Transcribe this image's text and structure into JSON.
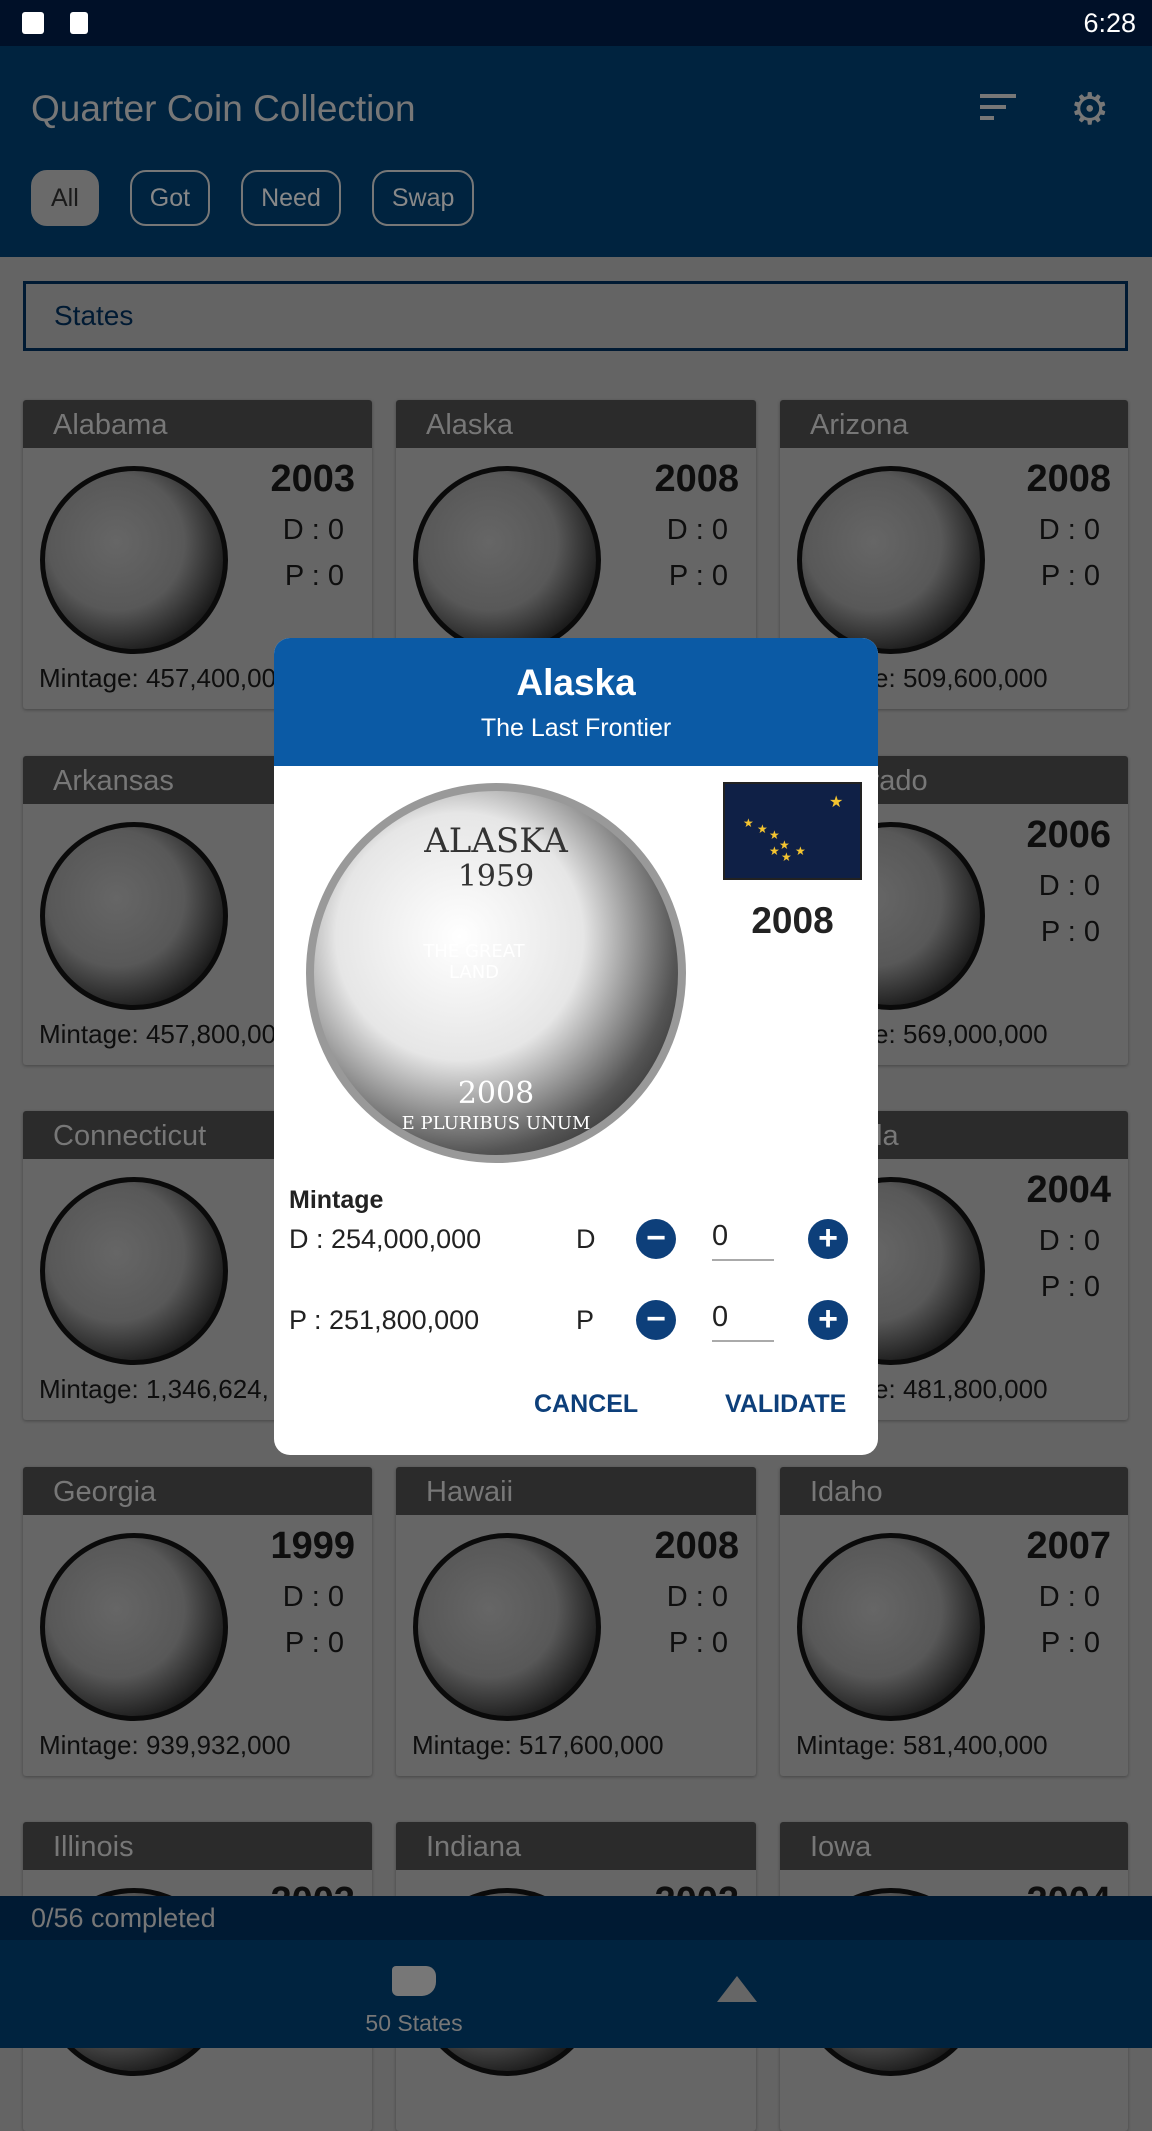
{
  "status_bar": {
    "time": "6:28",
    "icons": [
      "image-icon",
      "font-icon"
    ]
  },
  "app_bar": {
    "title": "Quarter Coin Collection",
    "icons": [
      "sort-icon",
      "gear-icon"
    ],
    "filters": [
      {
        "label": "All",
        "selected": true
      },
      {
        "label": "Got",
        "selected": false
      },
      {
        "label": "Need",
        "selected": false
      },
      {
        "label": "Swap",
        "selected": false
      }
    ]
  },
  "category_selector": {
    "value": "States"
  },
  "cards": [
    {
      "name": "Alabama",
      "year": "2003",
      "d": "D : 0",
      "p": "P : 0",
      "mintage": "Mintage: 457,400,00"
    },
    {
      "name": "Alaska",
      "year": "2008",
      "d": "D : 0",
      "p": "P : 0",
      "mintage": ""
    },
    {
      "name": "Arizona",
      "year": "2008",
      "d": "D : 0",
      "p": "P : 0",
      "mintage": "Mintage: 509,600,000"
    },
    {
      "name": "Arkansas",
      "year": "",
      "d": "",
      "p": "",
      "mintage": "Mintage: 457,800,00"
    },
    {
      "name": "",
      "year": "",
      "d": "",
      "p": "",
      "mintage": ""
    },
    {
      "name": "Colorado",
      "year": "2006",
      "d": "D : 0",
      "p": "P : 0",
      "mintage": "Mintage: 569,000,000"
    },
    {
      "name": "Connecticut",
      "year": "",
      "d": "",
      "p": "",
      "mintage": "Mintage: 1,346,624,"
    },
    {
      "name": "",
      "year": "",
      "d": "",
      "p": "",
      "mintage": ""
    },
    {
      "name": "Florida",
      "year": "2004",
      "d": "D : 0",
      "p": "P : 0",
      "mintage": "Mintage: 481,800,000"
    },
    {
      "name": "Georgia",
      "year": "1999",
      "d": "D : 0",
      "p": "P : 0",
      "mintage": "Mintage: 939,932,000"
    },
    {
      "name": "Hawaii",
      "year": "2008",
      "d": "D : 0",
      "p": "P : 0",
      "mintage": "Mintage: 517,600,000"
    },
    {
      "name": "Idaho",
      "year": "2007",
      "d": "D : 0",
      "p": "P : 0",
      "mintage": "Mintage: 581,400,000"
    },
    {
      "name": "Illinois",
      "year": "2003",
      "d": "",
      "p": "",
      "mintage": ""
    },
    {
      "name": "Indiana",
      "year": "2002",
      "d": "",
      "p": "",
      "mintage": ""
    },
    {
      "name": "Iowa",
      "year": "2004",
      "d": "",
      "p": "",
      "mintage": ""
    }
  ],
  "progress": {
    "text": "0/56 completed",
    "completed": 0,
    "total": 56
  },
  "bottom_nav": [
    {
      "label": "50 States",
      "icon": "usa-map-icon"
    },
    {
      "label": "",
      "icon": "mountain-icon"
    }
  ],
  "dialog": {
    "title": "Alaska",
    "subtitle": "The Last Frontier",
    "year": "2008",
    "coin_text": {
      "state": "ALASKA",
      "statehood": "1959",
      "motto": "THE GREAT LAND",
      "year": "2008",
      "legend": "E PLURIBUS UNUM"
    },
    "mintage_label": "Mintage",
    "mintage_d": "D : 254,000,000",
    "mintage_p": "P : 251,800,000",
    "d_label": "D",
    "p_label": "P",
    "d_count": "0",
    "p_count": "0",
    "cancel": "CANCEL",
    "validate": "VALIDATE",
    "colors": {
      "header": "#0b5aa5",
      "accent": "#0d3f7a"
    }
  }
}
